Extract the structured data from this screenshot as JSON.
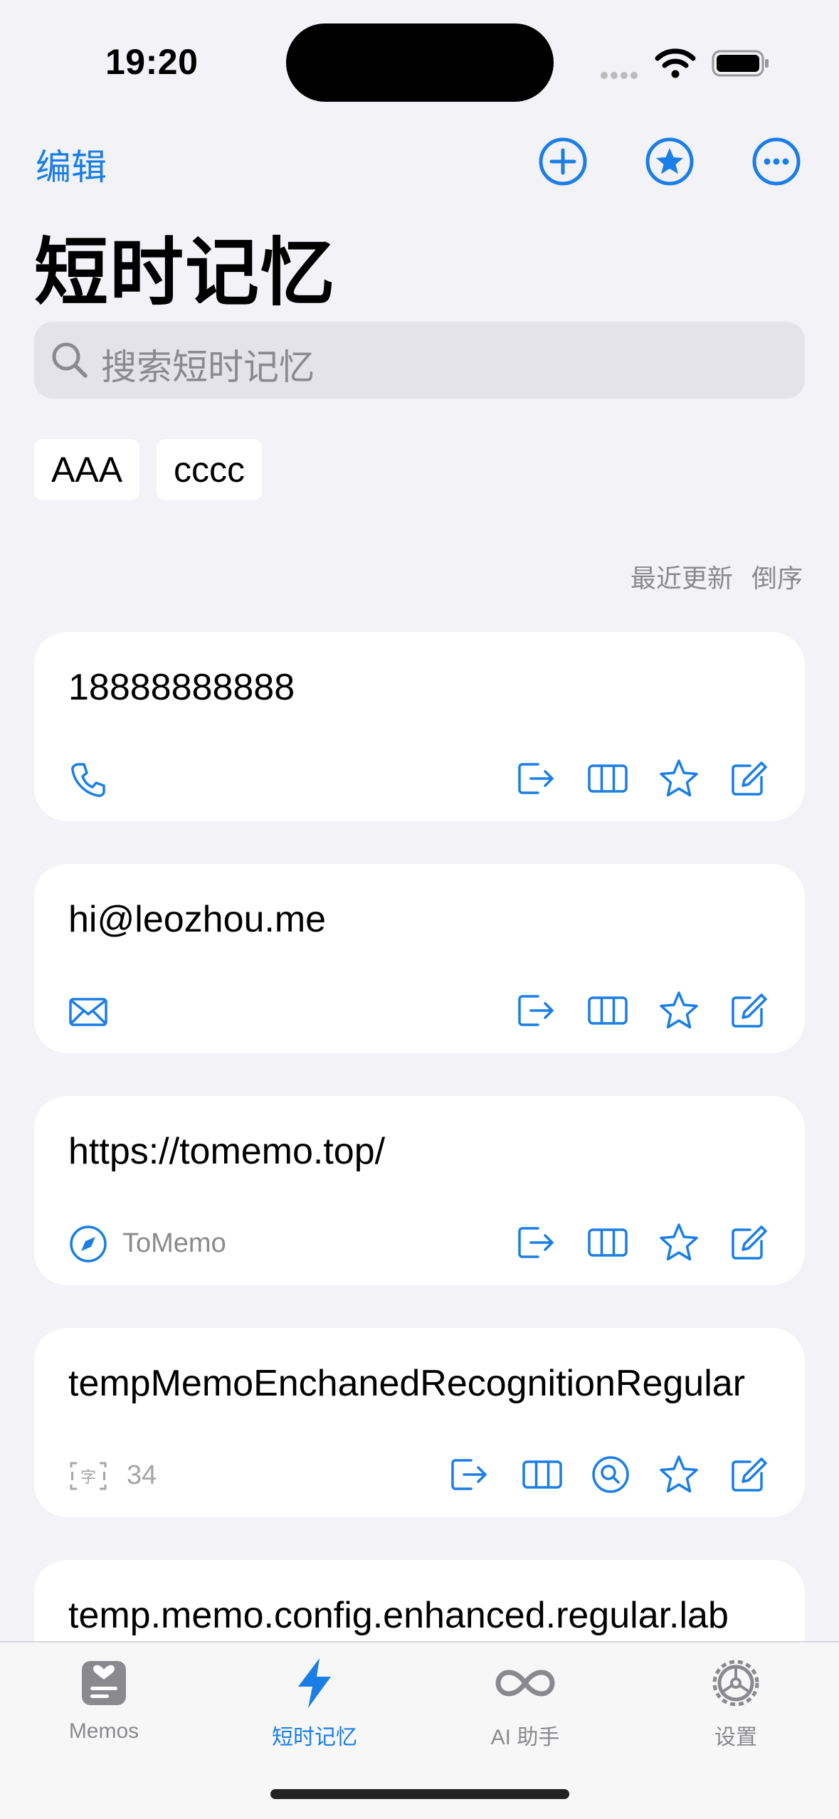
{
  "status_bar": {
    "time": "19:20"
  },
  "nav": {
    "edit_label": "编辑",
    "title": "短时记忆"
  },
  "search": {
    "placeholder": "搜索短时记忆"
  },
  "tags": [
    "AAA",
    "cccc"
  ],
  "sort": {
    "field": "最近更新",
    "order": "倒序"
  },
  "memos": [
    {
      "text": "18888888888",
      "type_icon": "phone-icon",
      "meta": ""
    },
    {
      "text": "hi@leozhou.me",
      "type_icon": "envelope-icon",
      "meta": ""
    },
    {
      "text": "https://tomemo.top/",
      "type_icon": "compass-icon",
      "meta": "ToMemo"
    },
    {
      "text": "tempMemoEnchanedRecognitionRegular",
      "type_icon": "char-count-icon",
      "meta": "34"
    },
    {
      "text": "temp.memo.config.enhanced.regular.lab",
      "type_icon": "",
      "meta": ""
    }
  ],
  "tabbar": {
    "tabs": [
      {
        "label": "Memos",
        "icon": "memo-card-icon",
        "active": false
      },
      {
        "label": "短时记忆",
        "icon": "bolt-icon",
        "active": true
      },
      {
        "label": "AI 助手",
        "icon": "infinity-icon",
        "active": false
      },
      {
        "label": "设置",
        "icon": "gear-icon",
        "active": false
      }
    ]
  },
  "colors": {
    "accent": "#1a7ee6",
    "background": "#f2f2f7",
    "secondary_text": "#8a8a8e"
  }
}
